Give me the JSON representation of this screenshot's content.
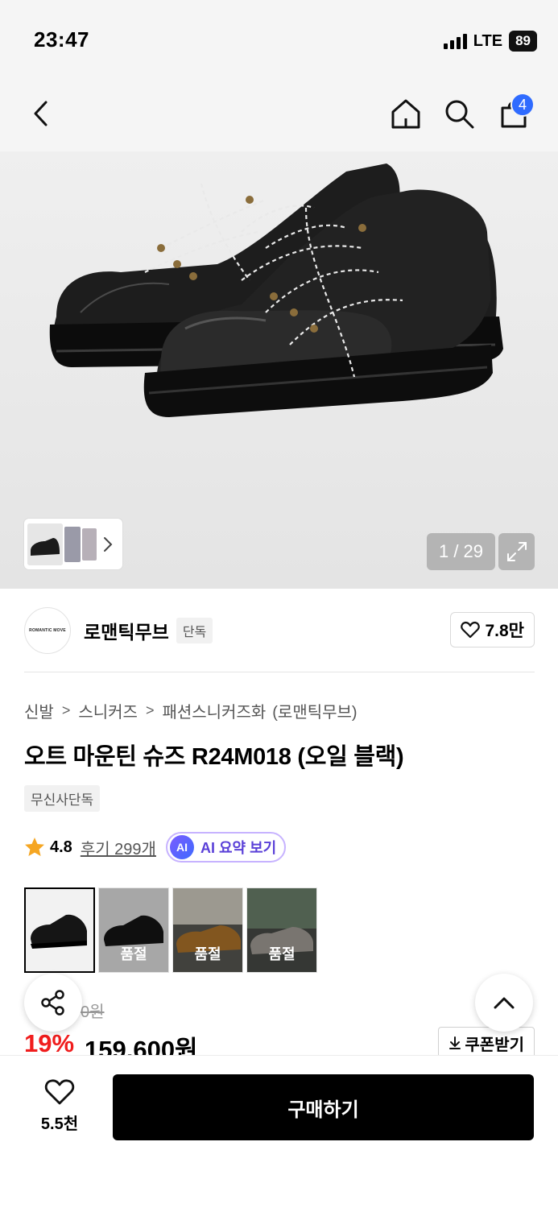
{
  "status_bar": {
    "time": "23:47",
    "network": "LTE",
    "battery": "89"
  },
  "nav": {
    "cart_count": "4"
  },
  "gallery": {
    "counter": "1 / 29"
  },
  "brand": {
    "logo_text": "ROMANTIC MOVE",
    "name": "로맨틱무브",
    "tag": "단독",
    "likes": "7.8만"
  },
  "breadcrumb": [
    "신발",
    "스니커즈",
    "패션스니커즈화",
    "(로맨틱무브)"
  ],
  "product": {
    "title": "오트 마운틴 슈즈 R24M018 (오일 블랙)",
    "exclusive_tag": "무신사단독",
    "rating": "4.8",
    "reviews": "후기 299개",
    "ai_badge": "AI",
    "ai_summary": "AI 요약 보기"
  },
  "options": [
    {
      "label": "",
      "soldout": false
    },
    {
      "label": "품절",
      "soldout": true
    },
    {
      "label": "품절",
      "soldout": true
    },
    {
      "label": "품절",
      "soldout": true
    }
  ],
  "price": {
    "original": "0원",
    "discount": "19%",
    "sale": "159,600원",
    "coupon": "쿠폰받기"
  },
  "bottom_bar": {
    "wish_count": "5.5천",
    "buy_label": "구매하기"
  },
  "colors": {
    "accent_blue": "#2f6bff",
    "discount_red": "#f01d1d",
    "ai_purple": "#5a40d8"
  }
}
